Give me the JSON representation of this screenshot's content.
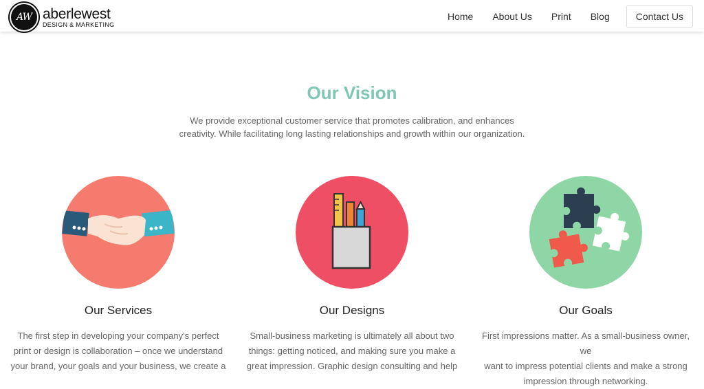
{
  "brand": {
    "mark": "AW",
    "name": "aberlewest",
    "tagline": "DESIGN & MARKETING"
  },
  "nav": {
    "home": "Home",
    "about": "About Us",
    "print": "Print",
    "blog": "Blog",
    "contact": "Contact Us"
  },
  "vision": {
    "title": "Our Vision",
    "line1": "We provide exceptional customer service that promotes calibration, and enhances",
    "line2": "creativity. While facilitating long lasting relationships and growth within our organization."
  },
  "cards": [
    {
      "icon": "handshake-icon",
      "color": "#f47b6e",
      "title": "Our Services",
      "lines": [
        "The first step in developing your company's perfect",
        "print or design is collaboration – once we understand",
        "your brand, your goals and your business, we create a"
      ]
    },
    {
      "icon": "pencil-cup-icon",
      "color": "#ef4f64",
      "title": "Our Designs",
      "lines": [
        "Small-business marketing is ultimately all about two",
        "things: getting noticed, and making sure you make a",
        "great impression. Graphic design consulting and help"
      ]
    },
    {
      "icon": "puzzle-icon",
      "color": "#8fd6a6",
      "title": "Our Goals",
      "lines": [
        "First impressions matter. As a small-business owner, we",
        "want to impress potential clients and make a strong",
        "impression through networking."
      ]
    }
  ],
  "colors": {
    "accent": "#7fc6b5"
  }
}
